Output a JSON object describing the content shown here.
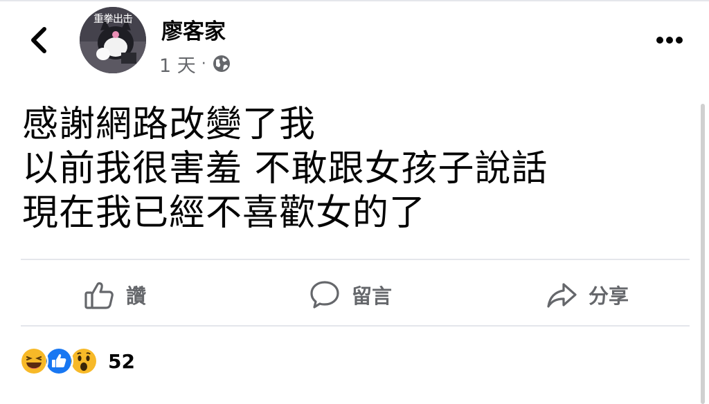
{
  "header": {
    "author_name": "廖客家",
    "timestamp": "1 天",
    "separator": "·",
    "audience_icon": "globe-icon",
    "avatar_caption": "重拳出击",
    "back_icon": "chevron-left-icon",
    "more_icon": "more-dots-icon"
  },
  "post": {
    "lines": [
      "感謝網路改變了我",
      "以前我很害羞 不敢跟女孩子說話",
      "現在我已經不喜歡女的了"
    ]
  },
  "actions": {
    "like_label": "讚",
    "comment_label": "留言",
    "share_label": "分享",
    "like_icon": "thumbs-up-icon",
    "comment_icon": "comment-bubble-icon",
    "share_icon": "share-arrow-icon"
  },
  "reactions": {
    "icons": [
      "haha-icon",
      "like-icon",
      "wow-icon"
    ],
    "count": "52",
    "colors": {
      "like_blue": "#1877f2",
      "emoji_yellow": "#f7b928",
      "muted_text": "#65676b"
    }
  }
}
